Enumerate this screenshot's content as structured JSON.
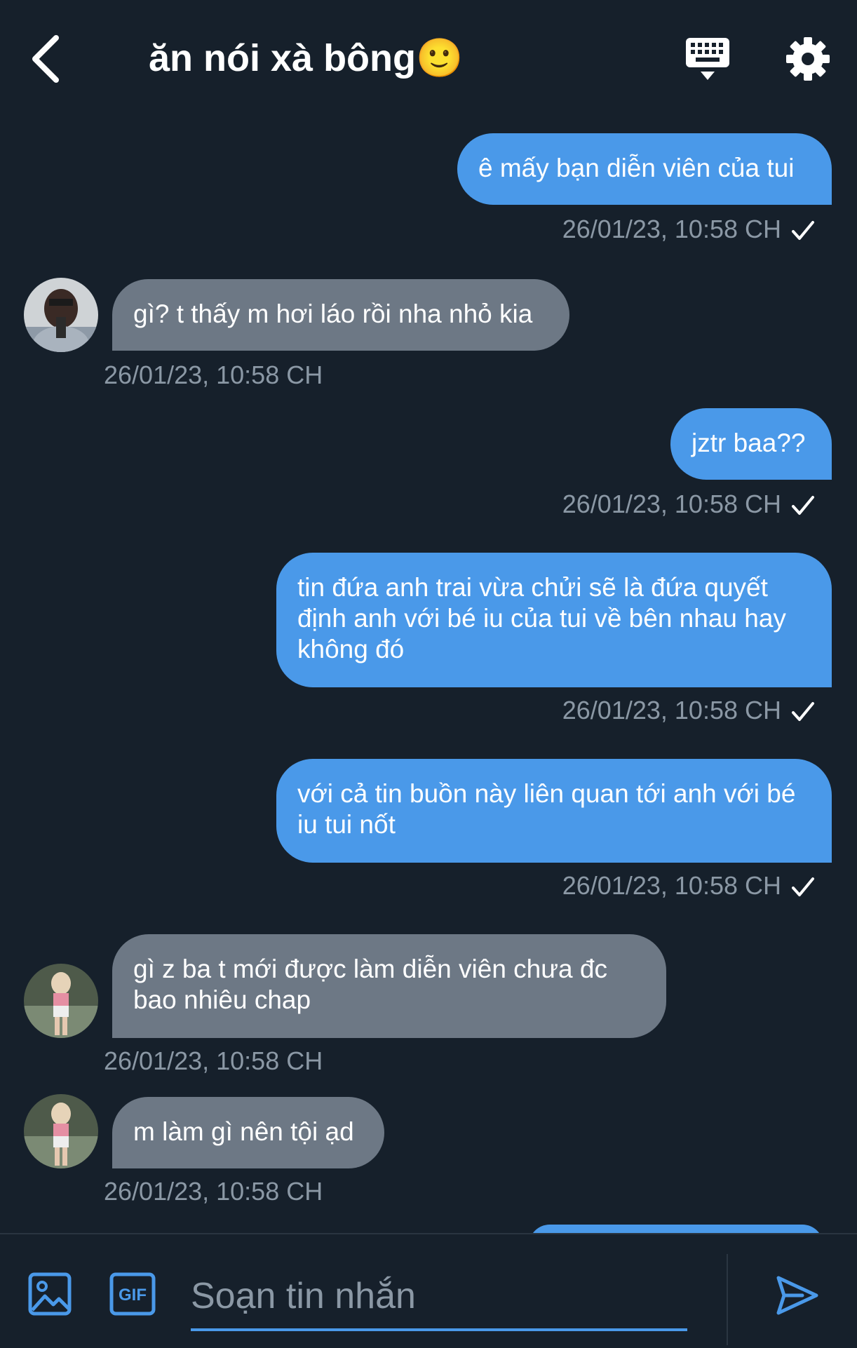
{
  "header": {
    "title": "ăn nói xà bông🙂"
  },
  "messages": [
    {
      "direction": "out",
      "text": "ê mấy bạn diễn viên của tui",
      "time": "26/01/23, 10:58 CH"
    },
    {
      "direction": "in",
      "text": "gì? t thấy m hơi láo rồi nha nhỏ kia",
      "time": "26/01/23, 10:58 CH"
    },
    {
      "direction": "out",
      "text": "jztr baa??",
      "time": "26/01/23, 10:58 CH"
    },
    {
      "direction": "out",
      "text": "tin đứa anh trai vừa chửi sẽ là đứa quyết định anh với bé iu của tui về bên nhau hay không đó",
      "time": "26/01/23, 10:58 CH"
    },
    {
      "direction": "out",
      "text": "với cả tin buồn này liên quan tới anh với bé iu tui nốt",
      "time": "26/01/23, 10:58 CH"
    },
    {
      "direction": "in",
      "text": "gì z ba t mới được làm diễn viên chưa đc bao nhiêu chap",
      "time": "26/01/23, 10:58 CH"
    },
    {
      "direction": "in",
      "text": "m làm gì nên tội ạd",
      "time": "26/01/23, 10:58 CH"
    }
  ],
  "composer": {
    "placeholder": "Soạn tin nhắn"
  },
  "colors": {
    "background": "#16202b",
    "outgoing_bubble": "#4a99e9",
    "incoming_bubble": "#6d7885",
    "timestamp": "#8b98a5",
    "accent": "#4a99e9"
  },
  "icons": {
    "back": "chevron-left-icon",
    "keyboard": "keyboard-icon",
    "settings": "gear-icon",
    "image": "image-icon",
    "gif": "gif-icon",
    "send": "send-icon"
  }
}
